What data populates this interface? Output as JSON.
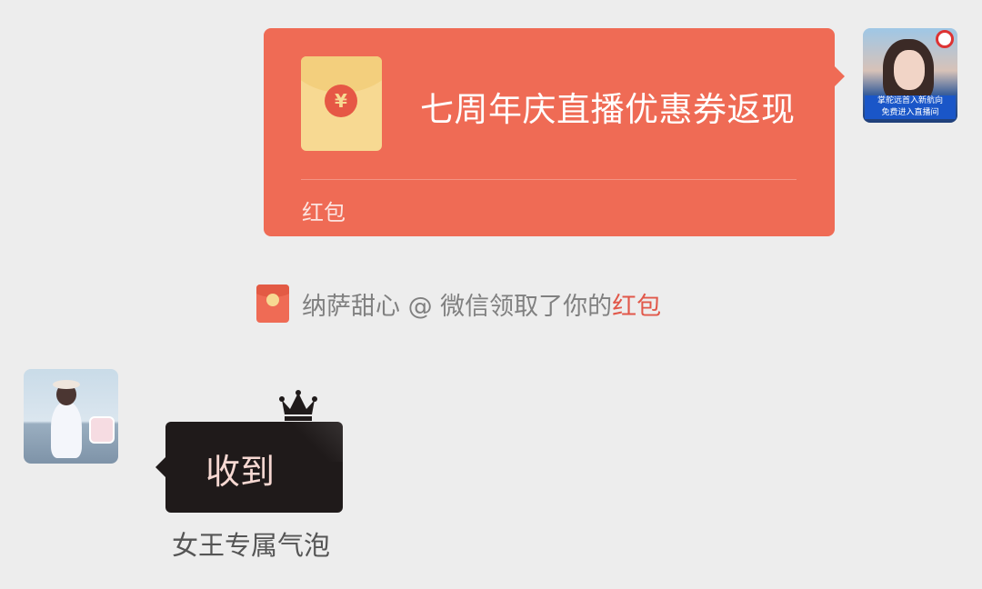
{
  "outgoing_packet": {
    "title": "七周年庆直播优惠券返现",
    "footer_label": "红包",
    "currency_symbol": "¥",
    "colors": {
      "bubble": "#EF6B55",
      "envelope": "#F7D992"
    }
  },
  "sender_avatar": {
    "banner_line_1": "掌舵远首入新航向",
    "banner_line_2": "免费进入直播间"
  },
  "notice": {
    "text": "纳萨甜心 @ 微信领取了你的",
    "link": "红包"
  },
  "incoming_message": {
    "text": "收到",
    "caption": "女王专属气泡",
    "colors": {
      "bubble": "#1F1A1A",
      "text": "#F6D8D2"
    }
  },
  "icons": {
    "envelope": "red-envelope-icon",
    "crown": "crown-icon"
  }
}
